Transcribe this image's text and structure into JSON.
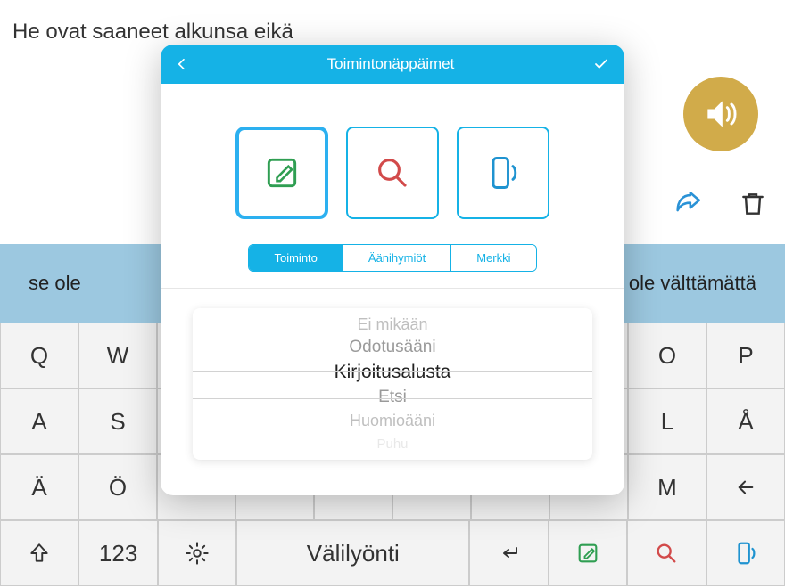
{
  "textArea": {
    "content": "He ovat saaneet alkunsa eikä"
  },
  "sideIcons": {
    "speak": "speaker-icon",
    "share": "share-icon",
    "trash": "trash-icon",
    "list": "list-icon",
    "smile": "smile-icon"
  },
  "suggestions": {
    "left": "se ole",
    "right": "ole välttämättä"
  },
  "keyboard": {
    "row1": [
      "Q",
      "W",
      "",
      "",
      "",
      "",
      "",
      "",
      "O",
      "P"
    ],
    "row2": [
      "A",
      "S",
      "",
      "",
      "",
      "",
      "",
      "",
      "L",
      "Å"
    ],
    "row3": [
      "Ä",
      "Ö",
      "",
      "",
      "",
      "",
      "",
      "",
      "M",
      "←"
    ],
    "bottom": {
      "shift": "⇧",
      "nums": "123",
      "gear": "⚙",
      "space": "Välilyönti",
      "ret": "↵",
      "edit": "✎",
      "search": "🔍",
      "phone": "📳"
    }
  },
  "modal": {
    "title": "Toimintonäppäimet",
    "bigIcons": {
      "edit": "edit-icon",
      "search": "search-icon",
      "phone": "phone-sound-icon"
    },
    "segments": {
      "a": "Toiminto",
      "b": "Äänihymiöt",
      "c": "Merkki"
    },
    "picker": {
      "opt0": "Ei mikään",
      "opt1": "Odotusääni",
      "opt2": "Kirjoitusalusta",
      "opt3": "Etsi",
      "opt4": "Huomioääni",
      "opt5": "Puhu"
    }
  }
}
